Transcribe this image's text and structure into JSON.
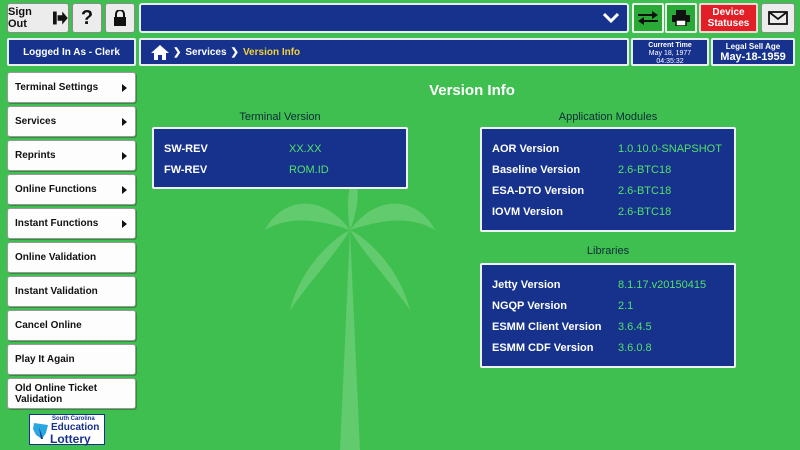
{
  "topbar": {
    "sign_out_label": "Sign Out",
    "help_label": "?",
    "device_statuses_label": "Device Statuses",
    "swap_icon": "swap-arrows-icon",
    "printer_icon": "printer-icon",
    "mail_icon": "envelope-icon",
    "lock_icon": "lock-icon",
    "dropdown_icon": "chevron-down-icon"
  },
  "login": {
    "text": "Logged In As - Clerk"
  },
  "breadcrumb": {
    "root": "Services",
    "current": "Version Info"
  },
  "current_time": {
    "label": "Current Time",
    "date": "May 18, 1977",
    "time": "04:35:32"
  },
  "legal_age": {
    "label": "Legal Sell Age",
    "date": "May-18-1959"
  },
  "sidebar": {
    "items": [
      {
        "label": "Terminal Settings",
        "arrow": true
      },
      {
        "label": "Services",
        "arrow": true
      },
      {
        "label": "Reprints",
        "arrow": true
      },
      {
        "label": "Online Functions",
        "arrow": true
      },
      {
        "label": "Instant Functions",
        "arrow": true
      },
      {
        "label": "Online Validation",
        "arrow": false
      },
      {
        "label": "Instant Validation",
        "arrow": false
      },
      {
        "label": "Cancel Online",
        "arrow": false
      },
      {
        "label": "Play It Again",
        "arrow": false
      },
      {
        "label": "Old Online Ticket Validation",
        "arrow": false
      }
    ]
  },
  "logo": {
    "line1": "South Carolina",
    "line2": "Education",
    "line3": "Lottery"
  },
  "page": {
    "title": "Version Info"
  },
  "terminal_version": {
    "title": "Terminal Version",
    "rows": [
      {
        "label": "SW-REV",
        "value": "XX.XX"
      },
      {
        "label": "FW-REV",
        "value": "ROM.ID"
      }
    ]
  },
  "application_modules": {
    "title": "Application Modules",
    "rows": [
      {
        "label": "AOR Version",
        "value": "1.0.10.0-SNAPSHOT"
      },
      {
        "label": "Baseline Version",
        "value": "2.6-BTC18"
      },
      {
        "label": "ESA-DTO Version",
        "value": "2.6-BTC18"
      },
      {
        "label": "IOVM Version",
        "value": "2.6-BTC18"
      }
    ]
  },
  "libraries": {
    "title": "Libraries",
    "rows": [
      {
        "label": "Jetty Version",
        "value": "8.1.17.v20150415"
      },
      {
        "label": "NGQP Version",
        "value": "2.1"
      },
      {
        "label": "ESMM Client Version",
        "value": "3.6.4.5"
      },
      {
        "label": "ESMM CDF Version",
        "value": "3.6.0.8"
      }
    ]
  },
  "colors": {
    "background": "#3fbf4f",
    "navy": "#16328c",
    "value_green": "#55e06a",
    "device_red": "#e21f26"
  }
}
